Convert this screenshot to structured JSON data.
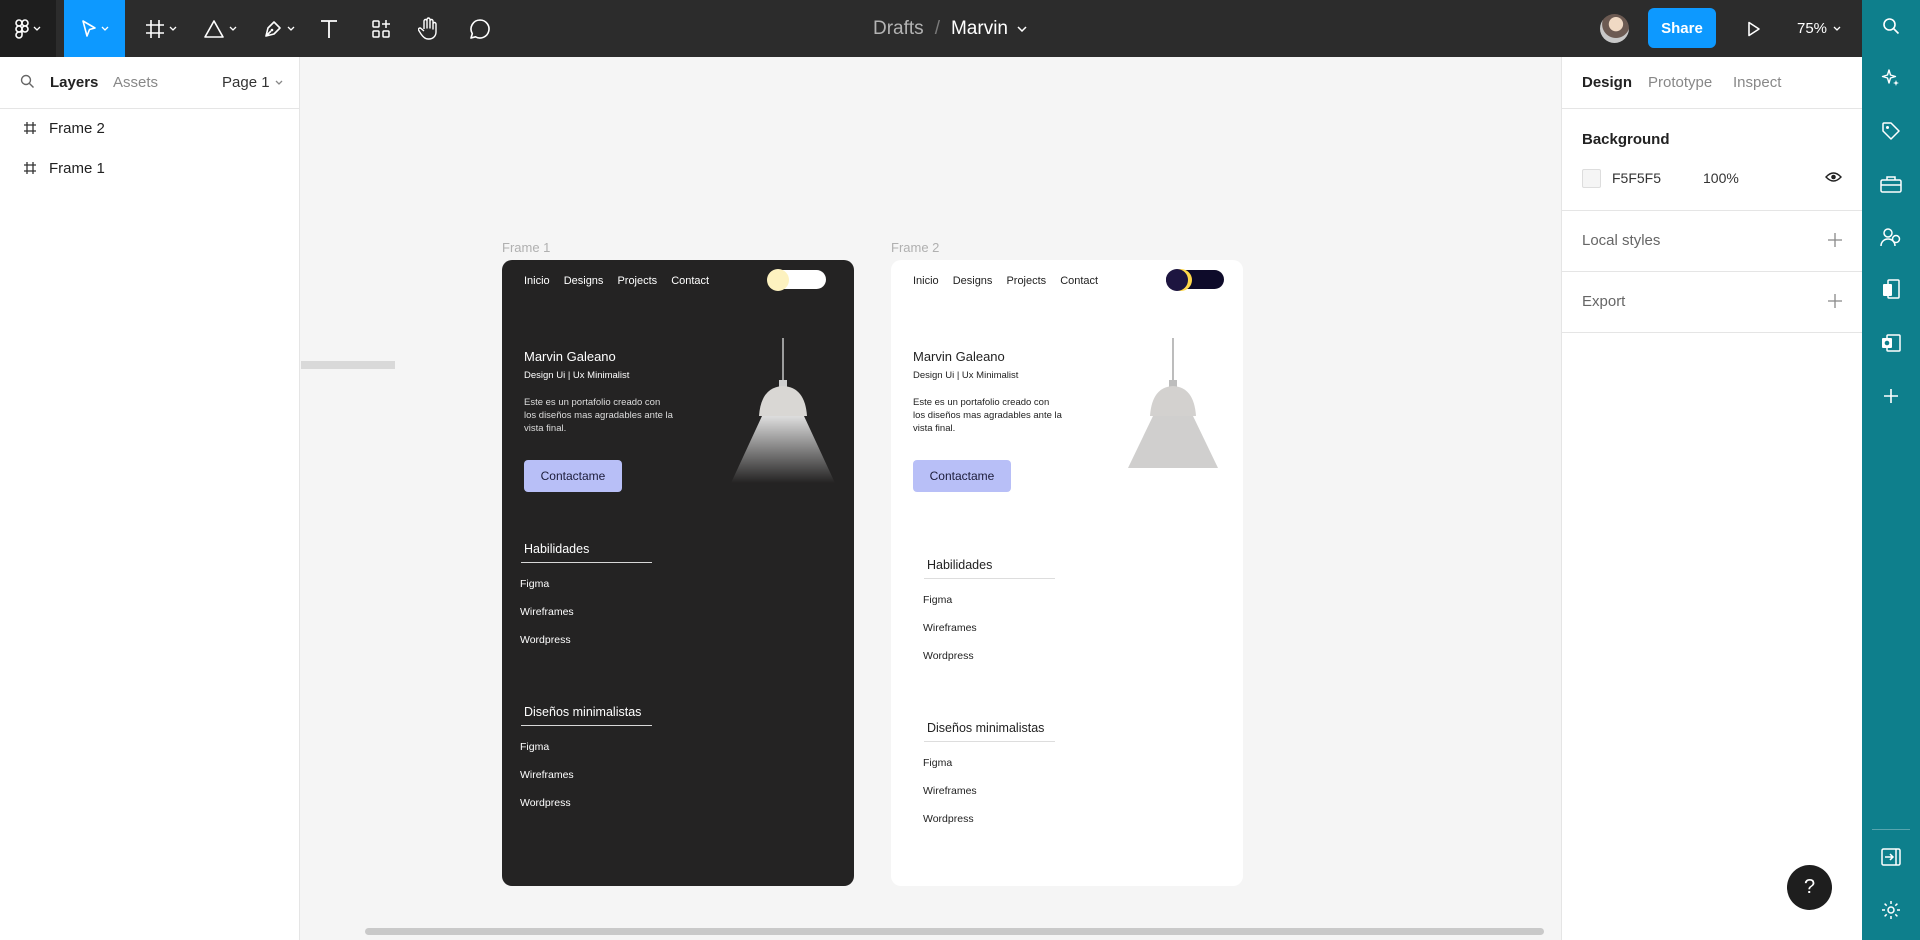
{
  "toolbar": {
    "breadcrumb_folder": "Drafts",
    "breadcrumb_separator": "/",
    "file_name": "Marvin",
    "share_label": "Share",
    "zoom_level": "75%"
  },
  "left_panel": {
    "tabs": {
      "layers": "Layers",
      "assets": "Assets"
    },
    "page_selector": "Page 1",
    "layers": [
      {
        "label": "Frame 2"
      },
      {
        "label": "Frame 1"
      }
    ]
  },
  "right_panel": {
    "tabs": {
      "design": "Design",
      "prototype": "Prototype",
      "inspect": "Inspect"
    },
    "background": {
      "title": "Background",
      "hex": "F5F5F5",
      "opacity": "100%"
    },
    "local_styles": "Local styles",
    "export": "Export"
  },
  "canvas": {
    "frames": [
      {
        "label": "Frame 1",
        "theme": "dark",
        "nav": [
          "Inicio",
          "Designs",
          "Projects",
          "Contact"
        ],
        "name": "Marvin Galeano",
        "role": "Design Ui | Ux Minimalist",
        "description": "Este es un portafolio creado con los diseños mas agradables ante la vista final.",
        "cta": "Contactame",
        "section1": {
          "title": "Habilidades",
          "items": [
            "Figma",
            "Wireframes",
            "Wordpress"
          ]
        },
        "section2": {
          "title": "Diseños minimalistas",
          "items": [
            "Figma",
            "Wireframes",
            "Wordpress"
          ]
        }
      },
      {
        "label": "Frame 2",
        "theme": "light",
        "nav": [
          "Inicio",
          "Designs",
          "Projects",
          "Contact"
        ],
        "name": "Marvin Galeano",
        "role": "Design Ui | Ux Minimalist",
        "description": "Este es un portafolio creado con los diseños mas agradables ante la vista final.",
        "cta": "Contactame",
        "section1": {
          "title": "Habilidades",
          "items": [
            "Figma",
            "Wireframes",
            "Wordpress"
          ]
        },
        "section2": {
          "title": "Diseños minimalistas",
          "items": [
            "Figma",
            "Wireframes",
            "Wordpress"
          ]
        }
      }
    ]
  },
  "help_label": "?",
  "colors": {
    "toolbar_bg": "#2c2c2c",
    "accent_blue": "#0d99ff",
    "plugin_rail": "#0e7f8c",
    "frame_dark_bg": "#242323",
    "cta_bg": "#b8bff7"
  }
}
